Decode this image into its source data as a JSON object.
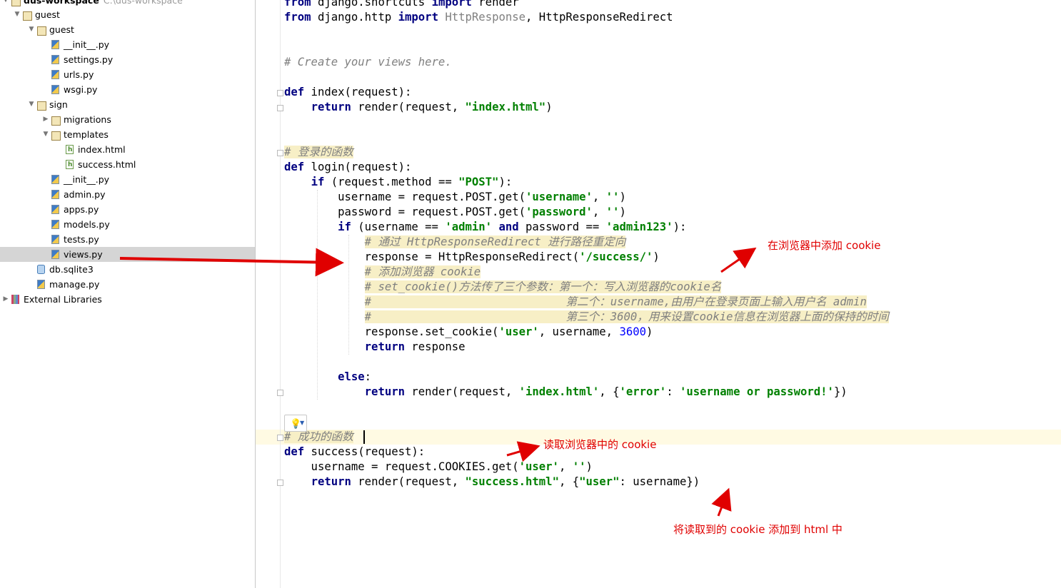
{
  "project_tree": {
    "root": {
      "name": "dus-workspace",
      "path": "C:\\dus-workspace"
    },
    "items": [
      {
        "name": "guest",
        "kind": "folder",
        "depth": 1,
        "expanded": true
      },
      {
        "name": "guest",
        "kind": "folder",
        "depth": 2,
        "expanded": true
      },
      {
        "name": "__init__.py",
        "kind": "py",
        "depth": 3
      },
      {
        "name": "settings.py",
        "kind": "py",
        "depth": 3
      },
      {
        "name": "urls.py",
        "kind": "py",
        "depth": 3
      },
      {
        "name": "wsgi.py",
        "kind": "py",
        "depth": 3
      },
      {
        "name": "sign",
        "kind": "folder",
        "depth": 2,
        "expanded": true
      },
      {
        "name": "migrations",
        "kind": "folder",
        "depth": 3,
        "expanded": false
      },
      {
        "name": "templates",
        "kind": "folder",
        "depth": 3,
        "expanded": true
      },
      {
        "name": "index.html",
        "kind": "html",
        "depth": 4
      },
      {
        "name": "success.html",
        "kind": "html",
        "depth": 4
      },
      {
        "name": "__init__.py",
        "kind": "py",
        "depth": 3
      },
      {
        "name": "admin.py",
        "kind": "py",
        "depth": 3
      },
      {
        "name": "apps.py",
        "kind": "py",
        "depth": 3
      },
      {
        "name": "models.py",
        "kind": "py",
        "depth": 3
      },
      {
        "name": "tests.py",
        "kind": "py",
        "depth": 3
      },
      {
        "name": "views.py",
        "kind": "py",
        "depth": 3,
        "selected": true
      },
      {
        "name": "db.sqlite3",
        "kind": "db",
        "depth": 2
      },
      {
        "name": "manage.py",
        "kind": "py",
        "depth": 2
      },
      {
        "name": "External Libraries",
        "kind": "libs",
        "depth": 0,
        "expanded": false
      }
    ]
  },
  "editor": {
    "lines": [
      [
        [
          "kw",
          "from"
        ],
        [
          "t",
          " django.shortcuts "
        ],
        [
          "kw",
          "import"
        ],
        [
          "t",
          " render"
        ]
      ],
      [
        [
          "kw",
          "from"
        ],
        [
          "t",
          " django.http "
        ],
        [
          "kw",
          "import"
        ],
        [
          "t",
          " "
        ],
        [
          "gray",
          "HttpResponse"
        ],
        [
          "t",
          ", HttpResponseRedirect"
        ]
      ],
      [],
      [],
      [
        [
          "cmt",
          "# Create your views here."
        ]
      ],
      [],
      [
        [
          "kw",
          "def"
        ],
        [
          "t",
          " index(request):"
        ]
      ],
      [
        [
          "t",
          "    "
        ],
        [
          "kw",
          "return"
        ],
        [
          "t",
          " render(request, "
        ],
        [
          "str",
          "\"index.html\""
        ],
        [
          "t",
          ")"
        ]
      ],
      [],
      [],
      [
        [
          "cmthl",
          "# 登录的函数"
        ]
      ],
      [
        [
          "kw",
          "def"
        ],
        [
          "t",
          " login(request):"
        ]
      ],
      [
        [
          "t",
          "    "
        ],
        [
          "kw",
          "if"
        ],
        [
          "t",
          " (request.method == "
        ],
        [
          "str",
          "\"POST\""
        ],
        [
          "t",
          "):"
        ]
      ],
      [
        [
          "t",
          "        username = request.POST.get("
        ],
        [
          "str",
          "'username'"
        ],
        [
          "t",
          ", "
        ],
        [
          "str",
          "''"
        ],
        [
          "t",
          ")"
        ]
      ],
      [
        [
          "t",
          "        password = request.POST.get("
        ],
        [
          "str",
          "'password'"
        ],
        [
          "t",
          ", "
        ],
        [
          "str",
          "''"
        ],
        [
          "t",
          ")"
        ]
      ],
      [
        [
          "t",
          "        "
        ],
        [
          "kw",
          "if"
        ],
        [
          "t",
          " (username == "
        ],
        [
          "str",
          "'admin'"
        ],
        [
          "t",
          " "
        ],
        [
          "kw",
          "and"
        ],
        [
          "t",
          " password == "
        ],
        [
          "str",
          "'admin123'"
        ],
        [
          "t",
          "):"
        ]
      ],
      [
        [
          "t",
          "            "
        ],
        [
          "cmthl",
          "# 通过 HttpResponseRedirect 进行路径重定向"
        ]
      ],
      [
        [
          "t",
          "            response = HttpResponseRedirect("
        ],
        [
          "str",
          "'/success/'"
        ],
        [
          "t",
          ")"
        ]
      ],
      [
        [
          "t",
          "            "
        ],
        [
          "cmthl",
          "# 添加浏览器 cookie"
        ]
      ],
      [
        [
          "t",
          "            "
        ],
        [
          "cmthl",
          "# set_cookie()方法传了三个参数：第一个：写入浏览器的cookie名"
        ]
      ],
      [
        [
          "t",
          "            "
        ],
        [
          "cmthl",
          "#                             第二个：username,由用户在登录页面上输入用户名 admin"
        ]
      ],
      [
        [
          "t",
          "            "
        ],
        [
          "cmthl",
          "#                             第三个：3600，用来设置cookie信息在浏览器上面的保持的时间"
        ]
      ],
      [
        [
          "t",
          "            response.set_cookie("
        ],
        [
          "str",
          "'user'"
        ],
        [
          "t",
          ", username, "
        ],
        [
          "num",
          "3600"
        ],
        [
          "t",
          ")"
        ]
      ],
      [
        [
          "t",
          "            "
        ],
        [
          "kw",
          "return"
        ],
        [
          "t",
          " response"
        ]
      ],
      [],
      [
        [
          "t",
          "        "
        ],
        [
          "kw",
          "else"
        ],
        [
          "t",
          ":"
        ]
      ],
      [
        [
          "t",
          "            "
        ],
        [
          "kw",
          "return"
        ],
        [
          "t",
          " render(request, "
        ],
        [
          "str",
          "'index.html'"
        ],
        [
          "t",
          ", {"
        ],
        [
          "str",
          "'error'"
        ],
        [
          "t",
          ": "
        ],
        [
          "str",
          "'username or password!'"
        ],
        [
          "t",
          "})"
        ]
      ],
      [],
      [],
      [
        [
          "cmthl",
          "# 成功的函数"
        ]
      ],
      [
        [
          "kw",
          "def"
        ],
        [
          "t",
          " success(request):"
        ]
      ],
      [
        [
          "t",
          "    username = request.COOKIES.get("
        ],
        [
          "str",
          "'user'"
        ],
        [
          "t",
          ", "
        ],
        [
          "str",
          "''"
        ],
        [
          "t",
          ")"
        ]
      ],
      [
        [
          "t",
          "    "
        ],
        [
          "kw",
          "return"
        ],
        [
          "t",
          " render(request, "
        ],
        [
          "str",
          "\"success.html\""
        ],
        [
          "t",
          ", {"
        ],
        [
          "str",
          "\"user\""
        ],
        [
          "t",
          ": username})"
        ]
      ]
    ]
  },
  "annotations": {
    "add_cookie": "在浏览器中添加 cookie",
    "read_cookie": "读取浏览器中的 cookie",
    "add_to_html": "将读取到的 cookie 添加到 html 中",
    "color": "#e00000"
  },
  "icons": {
    "folder": "folder-icon",
    "python_file": "python-file-icon",
    "html_file": "html-file-icon",
    "database": "database-icon",
    "libraries": "library-icon",
    "intention": "lightbulb-icon"
  }
}
